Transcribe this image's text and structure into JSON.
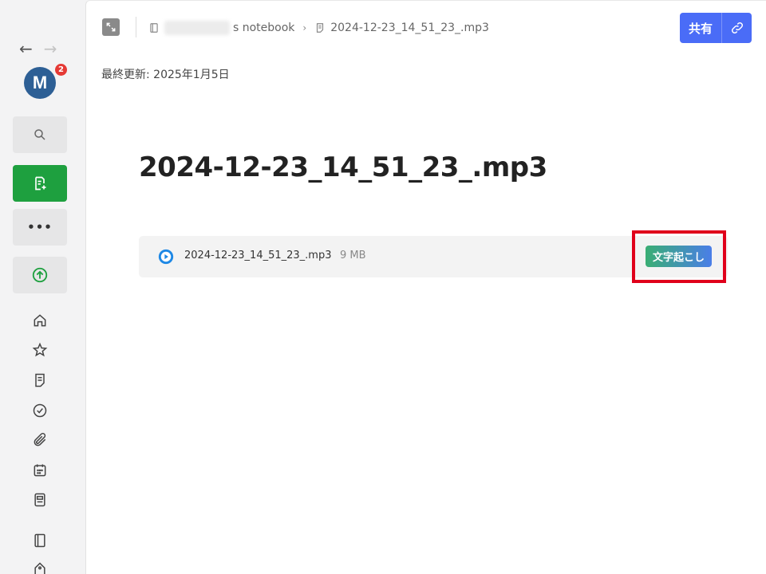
{
  "sidebar": {
    "back_icon": "arrow-left-icon",
    "forward_icon": "arrow-right-icon",
    "avatar": {
      "initial": "M",
      "badge_count": "2"
    },
    "buttons": [
      {
        "icon": "search-icon"
      },
      {
        "icon": "new-note-icon"
      },
      {
        "icon": "more-icon",
        "label": "•••"
      },
      {
        "icon": "upgrade-icon"
      }
    ],
    "nav_icons": [
      "home-icon",
      "star-icon",
      "note-icon",
      "task-icon",
      "attachment-icon",
      "calendar-icon",
      "template-icon",
      "notebook-icon",
      "tag-icon"
    ]
  },
  "header": {
    "notebook_suffix": "s notebook",
    "breadcrumb_separator": "›",
    "note_name": "2024-12-23_14_51_23_.mp3",
    "share_label": "共有"
  },
  "note": {
    "last_updated": "最終更新: 2025年1月5日",
    "title": "2024-12-23_14_51_23_.mp3",
    "attachment": {
      "file_name": "2024-12-23_14_51_23_.mp3",
      "file_size": "9 MB",
      "transcribe_label": "文字起こし"
    }
  },
  "colors": {
    "accent": "#4a6cf7",
    "new_note_green": "#1ea03f",
    "badge_red": "#e53935",
    "highlight": "#e0001b",
    "avatar": "#2d5f95"
  }
}
